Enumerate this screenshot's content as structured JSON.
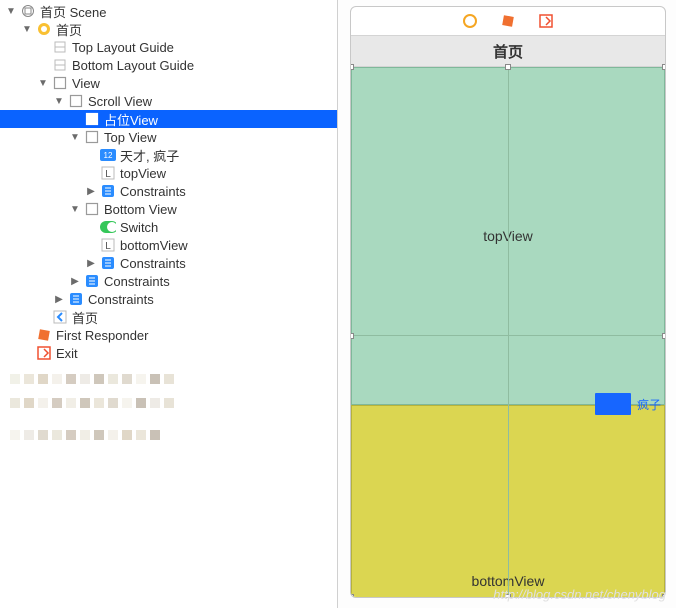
{
  "tree": [
    {
      "depth": 0,
      "disclosure": "▼",
      "icon": "scene",
      "label": "首页 Scene"
    },
    {
      "depth": 1,
      "disclosure": "▼",
      "icon": "vc",
      "label": "首页"
    },
    {
      "depth": 2,
      "disclosure": "",
      "icon": "guide",
      "label": "Top Layout Guide"
    },
    {
      "depth": 2,
      "disclosure": "",
      "icon": "guide",
      "label": "Bottom Layout Guide"
    },
    {
      "depth": 2,
      "disclosure": "▼",
      "icon": "view",
      "label": "View"
    },
    {
      "depth": 3,
      "disclosure": "▼",
      "icon": "view",
      "label": "Scroll View"
    },
    {
      "depth": 4,
      "disclosure": "",
      "icon": "view",
      "label": "占位View",
      "selected": true
    },
    {
      "depth": 4,
      "disclosure": "▼",
      "icon": "view",
      "label": "Top View"
    },
    {
      "depth": 5,
      "disclosure": "",
      "icon": "badge12",
      "label": "天才, 疯子"
    },
    {
      "depth": 5,
      "disclosure": "",
      "icon": "L",
      "label": "topView"
    },
    {
      "depth": 5,
      "disclosure": "▶",
      "icon": "constraints",
      "label": "Constraints"
    },
    {
      "depth": 4,
      "disclosure": "▼",
      "icon": "view",
      "label": "Bottom View"
    },
    {
      "depth": 5,
      "disclosure": "",
      "icon": "switch",
      "label": "Switch"
    },
    {
      "depth": 5,
      "disclosure": "",
      "icon": "L",
      "label": "bottomView"
    },
    {
      "depth": 5,
      "disclosure": "▶",
      "icon": "constraints",
      "label": "Constraints"
    },
    {
      "depth": 4,
      "disclosure": "▶",
      "icon": "constraints",
      "label": "Constraints"
    },
    {
      "depth": 3,
      "disclosure": "▶",
      "icon": "constraints",
      "label": "Constraints"
    },
    {
      "depth": 2,
      "disclosure": "",
      "icon": "back",
      "label": "首页"
    },
    {
      "depth": 1,
      "disclosure": "",
      "icon": "responder",
      "label": "First Responder"
    },
    {
      "depth": 1,
      "disclosure": "",
      "icon": "exit",
      "label": "Exit"
    }
  ],
  "editor": {
    "navTitle": "首页",
    "topViewLabel": "topView",
    "bottomViewLabel": "bottomView",
    "switchLabel": "疯子"
  },
  "watermark": "http://blog.csdn.net/chenyblog"
}
